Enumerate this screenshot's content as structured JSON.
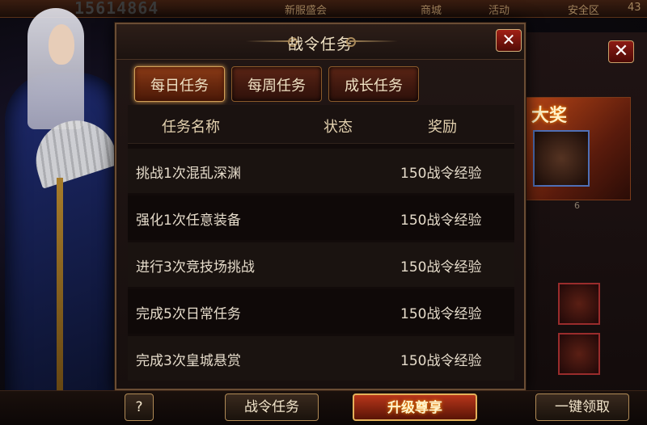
{
  "topbar": {
    "score": "15614864",
    "text_1": "新服盛会",
    "text_2": "商城",
    "text_3": "活动",
    "text_4": "安全区",
    "number": "43"
  },
  "modal": {
    "title": "战令任务",
    "close_symbol": "✕",
    "tabs": [
      {
        "label": "每日任务",
        "active": true
      },
      {
        "label": "每周任务",
        "active": false
      },
      {
        "label": "成长任务",
        "active": false
      }
    ],
    "columns": [
      "任务名称",
      "状态",
      "奖励"
    ],
    "tasks": [
      {
        "name": "挑战1次混乱深渊",
        "status": "",
        "reward": "150战令经验"
      },
      {
        "name": "强化1次任意装备",
        "status": "",
        "reward": "150战令经验"
      },
      {
        "name": "进行3次竞技场挑战",
        "status": "",
        "reward": "150战令经验"
      },
      {
        "name": "完成5次日常任务",
        "status": "",
        "reward": "150战令经验"
      },
      {
        "name": "完成3次皇城悬赏",
        "status": "",
        "reward": "150战令经验"
      }
    ]
  },
  "side_panel": {
    "award_label": "大奖",
    "count": "6"
  },
  "bottom": {
    "help_label": "?",
    "task_label": "战令任务",
    "upgrade_label": "升级尊享",
    "claim_all_label": "一键领取"
  },
  "colors": {
    "accent_gold": "#d2a058",
    "close_red": "#a12016",
    "panel_bg": "#170f0e"
  }
}
